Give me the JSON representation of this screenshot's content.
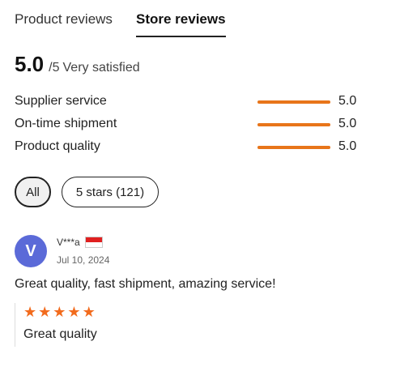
{
  "tabs": {
    "product": "Product reviews",
    "store": "Store reviews"
  },
  "summary": {
    "score": "5.0",
    "max": "/5",
    "label": "Very satisfied"
  },
  "metrics": [
    {
      "label": "Supplier service",
      "value": "5.0",
      "fraction": 1.0
    },
    {
      "label": "On-time shipment",
      "value": "5.0",
      "fraction": 1.0
    },
    {
      "label": "Product quality",
      "value": "5.0",
      "fraction": 1.0
    }
  ],
  "filters": {
    "all": "All",
    "five_stars": "5 stars (121)"
  },
  "review": {
    "avatar_initial": "V",
    "reviewer": "V***a",
    "flag": "red-white-flag-icon",
    "date": "Jul 10, 2024",
    "text": "Great quality, fast shipment, amazing service!",
    "stars": 5,
    "detail": "Great quality"
  },
  "colors": {
    "accent": "#e8751a",
    "avatar": "#5b6ad8",
    "star": "#f26b1d"
  }
}
